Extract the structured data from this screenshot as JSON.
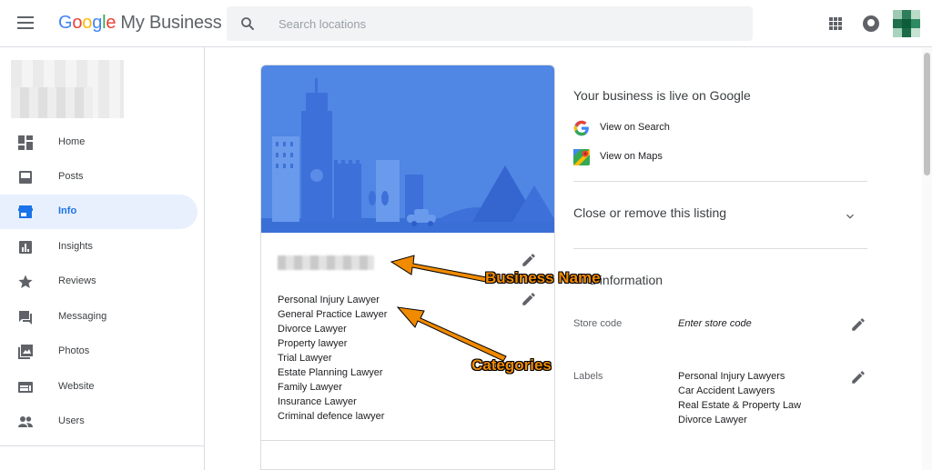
{
  "app": {
    "logo_google": [
      "G",
      "o",
      "o",
      "g",
      "l",
      "e"
    ],
    "logo_product": "My Business"
  },
  "search": {
    "placeholder": "Search locations",
    "value": ""
  },
  "header_icons": [
    "menu-icon",
    "apps-grid-icon",
    "notifications-icon",
    "account-avatar"
  ],
  "sidebar": {
    "items": [
      {
        "label": "Home",
        "icon": "dashboard-icon",
        "active": false
      },
      {
        "label": "Posts",
        "icon": "posts-icon",
        "active": false
      },
      {
        "label": "Info",
        "icon": "storefront-icon",
        "active": true
      },
      {
        "label": "Insights",
        "icon": "bar-chart-icon",
        "active": false
      },
      {
        "label": "Reviews",
        "icon": "star-icon",
        "active": false
      },
      {
        "label": "Messaging",
        "icon": "chat-icon",
        "active": false
      },
      {
        "label": "Photos",
        "icon": "photo-icon",
        "active": false
      },
      {
        "label": "Website",
        "icon": "web-icon",
        "active": false
      },
      {
        "label": "Users",
        "icon": "people-icon",
        "active": false
      }
    ]
  },
  "profile_card": {
    "categories": [
      "Personal Injury Lawyer",
      "General Practice Lawyer",
      "Divorce Lawyer",
      "Property lawyer",
      "Trial Lawyer",
      "Estate Planning Lawyer",
      "Family Lawyer",
      "Insurance Lawyer",
      "Criminal defence lawyer"
    ]
  },
  "right_panel": {
    "live_title": "Your business is live on Google",
    "view_on_search": "View on Search",
    "view_on_maps": "View on Maps",
    "close_listing": "Close or remove this listing",
    "additional_info_partial": "d information",
    "store_code_label": "Store code",
    "store_code_placeholder": "Enter store code",
    "labels_label": "Labels",
    "labels": [
      "Personal Injury Lawyers",
      "Car Accident Lawyers",
      "Real Estate & Property Law",
      "Divorce Lawyer"
    ]
  },
  "annotations": {
    "business_name": "Business Name",
    "categories": "Categories"
  },
  "colors": {
    "accent": "#1a73e8",
    "active_bg": "#e8f0fe",
    "hero_bg": "#4a7fe0",
    "annotation": "#f08a00"
  }
}
